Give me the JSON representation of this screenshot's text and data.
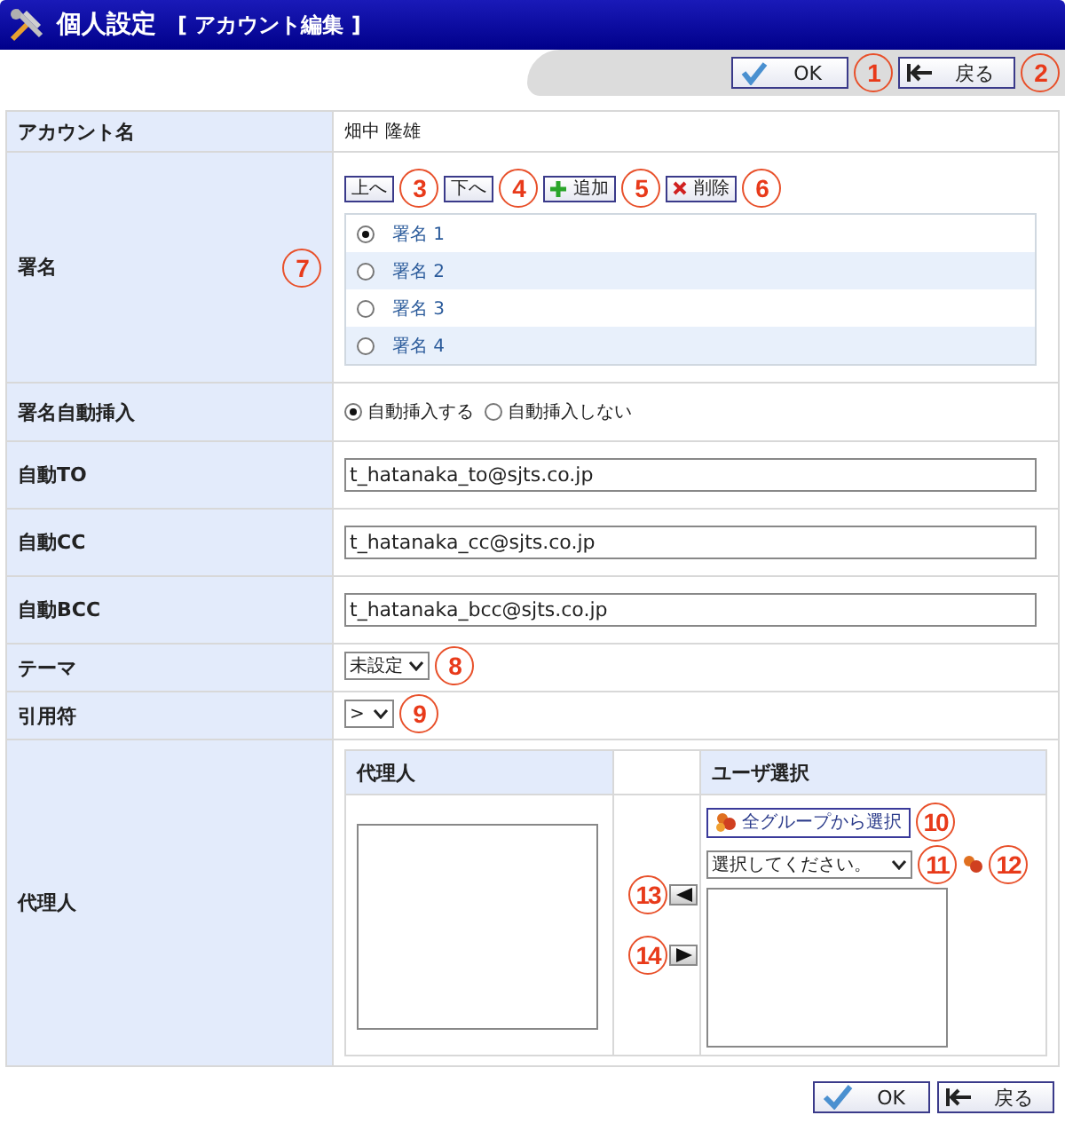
{
  "header": {
    "title": "個人設定",
    "subtitle": "[ アカウント編集 ]"
  },
  "top_buttons": [
    {
      "label": "OK",
      "kind": "ok"
    },
    {
      "label": "戻る",
      "kind": "back"
    }
  ],
  "account": {
    "label": "アカウント名",
    "value": "畑中 隆雄"
  },
  "signature": {
    "label": "署名",
    "buttons": [
      {
        "label": "上へ",
        "kind": "plain"
      },
      {
        "label": "下へ",
        "kind": "plain"
      },
      {
        "label": "追加",
        "kind": "add"
      },
      {
        "label": "削除",
        "kind": "delete"
      }
    ],
    "items": [
      {
        "label": "署名 1",
        "selected": true
      },
      {
        "label": "署名 2",
        "selected": false
      },
      {
        "label": "署名 3",
        "selected": false
      },
      {
        "label": "署名 4",
        "selected": false
      }
    ]
  },
  "auto_insert": {
    "label": "署名自動挿入",
    "options": [
      {
        "label": "自動挿入する",
        "selected": true
      },
      {
        "label": "自動挿入しない",
        "selected": false
      }
    ]
  },
  "fields": [
    {
      "label": "自動TO",
      "value": "t_hatanaka_to@sjts.co.jp"
    },
    {
      "label": "自動CC",
      "value": "t_hatanaka_cc@sjts.co.jp"
    },
    {
      "label": "自動BCC",
      "value": "t_hatanaka_bcc@sjts.co.jp"
    }
  ],
  "theme": {
    "label": "テーマ",
    "value": "未設定"
  },
  "quote": {
    "label": "引用符",
    "value": ">"
  },
  "proxy": {
    "label": "代理人",
    "left_header": "代理人",
    "right_header": "ユーザ選択",
    "group_button": "全グループから選択",
    "group_select": "選択してください。"
  },
  "bottom_buttons": [
    {
      "label": "OK",
      "kind": "ok"
    },
    {
      "label": "戻る",
      "kind": "back"
    }
  ],
  "callouts": [
    "1",
    "2",
    "3",
    "4",
    "5",
    "6",
    "7",
    "8",
    "9",
    "10",
    "11",
    "12",
    "13",
    "14"
  ]
}
